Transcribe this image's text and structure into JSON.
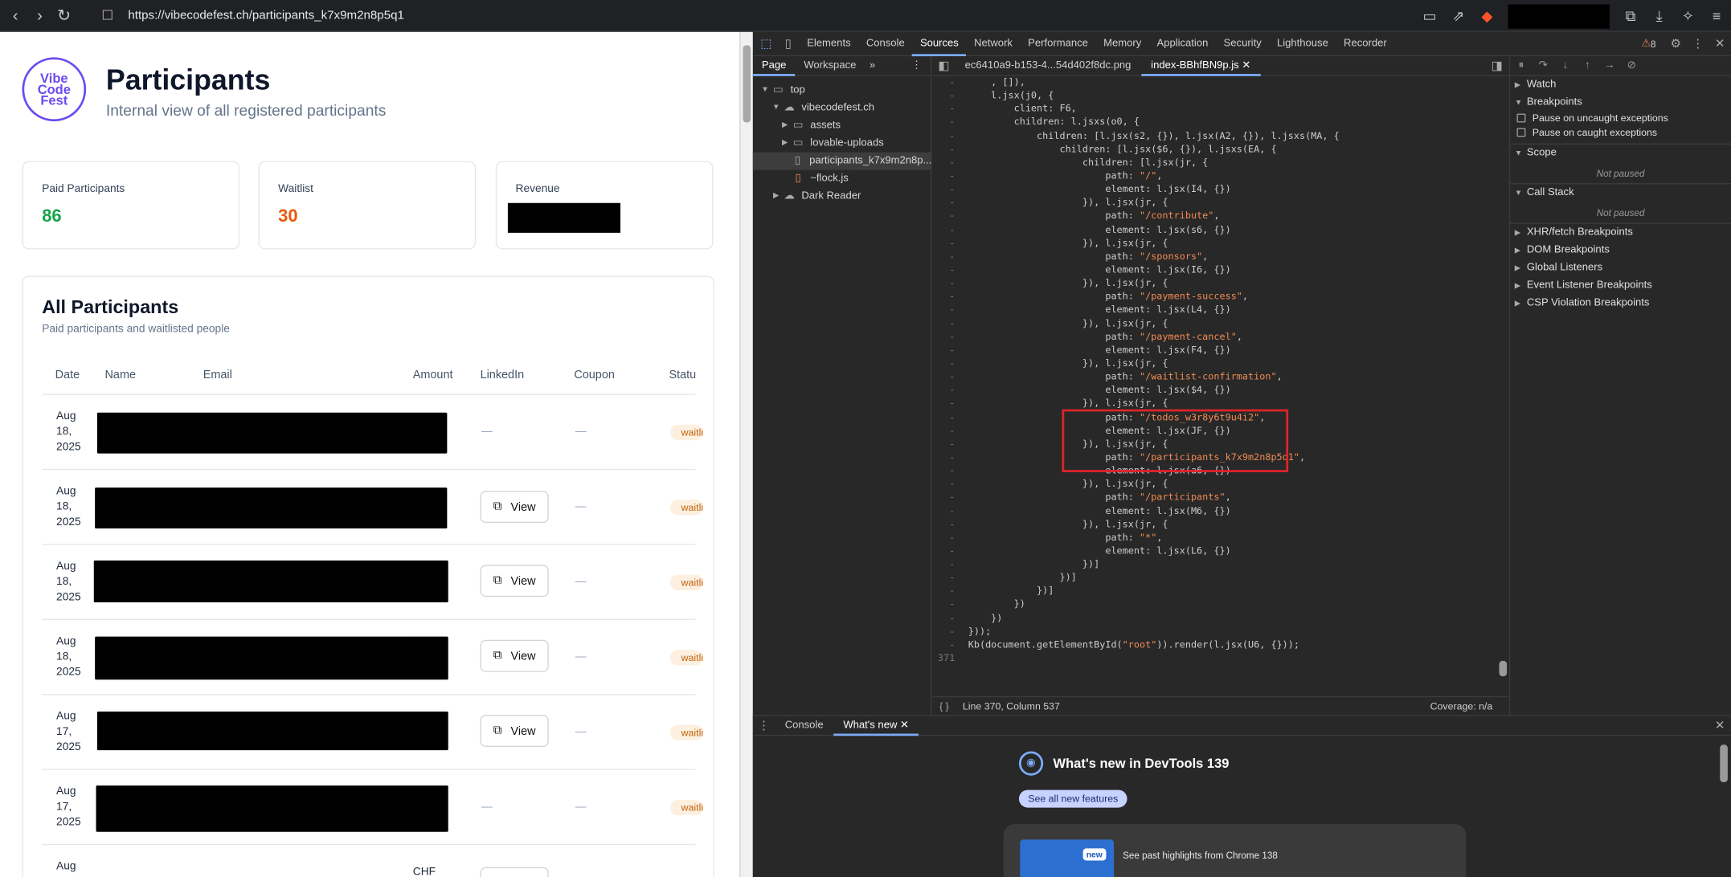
{
  "browser": {
    "url": "https://vibecodefest.ch/participants_k7x9m2n8p5q1",
    "back_icon": "chevron-left-icon",
    "forward_icon": "chevron-right-icon",
    "reload_icon": "reload-icon",
    "bookmark_icon": "bookmark-icon"
  },
  "page": {
    "logo_lines": [
      "Vibe",
      "Code",
      "Fest"
    ],
    "title": "Participants",
    "subtitle": "Internal view of all registered participants",
    "stats": [
      {
        "label": "Paid Participants",
        "value": "86",
        "color": "#16a34a"
      },
      {
        "label": "Waitlist",
        "value": "30",
        "color": "#ea580c"
      },
      {
        "label": "Revenue",
        "value": ""
      }
    ],
    "table": {
      "title": "All Participants",
      "subtitle": "Paid participants and waitlisted people",
      "columns": [
        "Date",
        "Name",
        "Email",
        "Amount",
        "LinkedIn",
        "Coupon",
        "Status"
      ],
      "rows": [
        {
          "month": "Aug",
          "day": "18,",
          "year": "2025",
          "linkedin": "—",
          "coupon": "—",
          "status": "waitlist"
        },
        {
          "month": "Aug",
          "day": "18,",
          "year": "2025",
          "linkedin": "View",
          "coupon": "—",
          "status": "waitlist"
        },
        {
          "month": "Aug",
          "day": "18,",
          "year": "2025",
          "linkedin": "View",
          "coupon": "—",
          "status": "waitlist"
        },
        {
          "month": "Aug",
          "day": "18,",
          "year": "2025",
          "linkedin": "View",
          "coupon": "—",
          "status": "waitlist"
        },
        {
          "month": "Aug",
          "day": "17,",
          "year": "2025",
          "linkedin": "View",
          "coupon": "—",
          "status": "waitlist"
        },
        {
          "month": "Aug",
          "day": "17,",
          "year": "2025",
          "linkedin": "—",
          "coupon": "—",
          "status": "waitlist"
        },
        {
          "month": "Aug",
          "day": "",
          "year": "",
          "amount": "CHF",
          "linkedin": "",
          "coupon": "",
          "status": ""
        }
      ]
    }
  },
  "devtools": {
    "tabs": [
      "Elements",
      "Console",
      "Sources",
      "Network",
      "Performance",
      "Memory",
      "Application",
      "Security",
      "Lighthouse",
      "Recorder"
    ],
    "active_tab": "Sources",
    "warning_count": "8",
    "navigator": {
      "tabs": [
        "Page",
        "Workspace"
      ],
      "tree": [
        {
          "label": "top",
          "indent": 0,
          "arrow": "▼",
          "icon": "frame-icon"
        },
        {
          "label": "vibecodefest.ch",
          "indent": 1,
          "arrow": "▼",
          "icon": "cloud-icon"
        },
        {
          "label": "assets",
          "indent": 2,
          "arrow": "▶",
          "icon": "folder-icon"
        },
        {
          "label": "lovable-uploads",
          "indent": 2,
          "arrow": "▶",
          "icon": "folder-icon"
        },
        {
          "label": "participants_k7x9m2n8p...",
          "indent": 2,
          "arrow": "",
          "icon": "file-icon",
          "selected": true
        },
        {
          "label": "~flock.js",
          "indent": 2,
          "arrow": "",
          "icon": "file-icon"
        },
        {
          "label": "Dark Reader",
          "indent": 0,
          "arrow": "▶",
          "icon": "cloud-icon"
        }
      ]
    },
    "editor_tabs": [
      "ec6410a9-b153-4...54d402f8dc.png",
      "index-BBhfBN9p.js"
    ],
    "code_lines": [
      {
        "n": "-",
        "t": "    , []),"
      },
      {
        "n": "-",
        "t": "    l.jsx(j0, {"
      },
      {
        "n": "-",
        "t": "        client: F6,"
      },
      {
        "n": "-",
        "t": "        children: l.jsxs(o0, {"
      },
      {
        "n": "-",
        "t": "            children: [l.jsx(s2, {}), l.jsx(A2, {}), l.jsxs(MA, {"
      },
      {
        "n": "-",
        "t": "                children: [l.jsx($6, {}), l.jsxs(EA, {"
      },
      {
        "n": "-",
        "t": "                    children: [l.jsx(jr, {"
      },
      {
        "n": "-",
        "t": "                        path: ",
        "s": "\"/\"",
        "e": ","
      },
      {
        "n": "-",
        "t": "                        element: l.jsx(I4, {})"
      },
      {
        "n": "-",
        "t": "                    }), l.jsx(jr, {"
      },
      {
        "n": "-",
        "t": "                        path: ",
        "s": "\"/contribute\"",
        "e": ","
      },
      {
        "n": "-",
        "t": "                        element: l.jsx(s6, {})"
      },
      {
        "n": "-",
        "t": "                    }), l.jsx(jr, {"
      },
      {
        "n": "-",
        "t": "                        path: ",
        "s": "\"/sponsors\"",
        "e": ","
      },
      {
        "n": "-",
        "t": "                        element: l.jsx(I6, {})"
      },
      {
        "n": "-",
        "t": "                    }), l.jsx(jr, {"
      },
      {
        "n": "-",
        "t": "                        path: ",
        "s": "\"/payment-success\"",
        "e": ","
      },
      {
        "n": "-",
        "t": "                        element: l.jsx(L4, {})"
      },
      {
        "n": "-",
        "t": "                    }), l.jsx(jr, {"
      },
      {
        "n": "-",
        "t": "                        path: ",
        "s": "\"/payment-cancel\"",
        "e": ","
      },
      {
        "n": "-",
        "t": "                        element: l.jsx(F4, {})"
      },
      {
        "n": "-",
        "t": "                    }), l.jsx(jr, {"
      },
      {
        "n": "-",
        "t": "                        path: ",
        "s": "\"/waitlist-confirmation\"",
        "e": ","
      },
      {
        "n": "-",
        "t": "                        element: l.jsx($4, {})"
      },
      {
        "n": "-",
        "t": "                    }), l.jsx(jr, {"
      },
      {
        "n": "-",
        "t": "                        path: ",
        "s": "\"/todos_w3r8y6t9u4i2\"",
        "e": ","
      },
      {
        "n": "-",
        "t": "                        element: l.jsx(JF, {})"
      },
      {
        "n": "-",
        "t": "                    }), l.jsx(jr, {"
      },
      {
        "n": "-",
        "t": "                        path: ",
        "s": "\"/participants_k7x9m2n8p5q1\"",
        "e": ","
      },
      {
        "n": "-",
        "t": "                        element: l.jsx(a6, {})"
      },
      {
        "n": "-",
        "t": "                    }), l.jsx(jr, {"
      },
      {
        "n": "-",
        "t": "                        path: ",
        "s": "\"/participants\"",
        "e": ","
      },
      {
        "n": "-",
        "t": "                        element: l.jsx(M6, {})"
      },
      {
        "n": "-",
        "t": "                    }), l.jsx(jr, {"
      },
      {
        "n": "-",
        "t": "                        path: ",
        "s": "\"*\"",
        "e": ","
      },
      {
        "n": "-",
        "t": "                        element: l.jsx(L6, {})"
      },
      {
        "n": "-",
        "t": "                    })]"
      },
      {
        "n": "-",
        "t": "                })]"
      },
      {
        "n": "-",
        "t": "            })]"
      },
      {
        "n": "-",
        "t": "        })"
      },
      {
        "n": "-",
        "t": "    })"
      },
      {
        "n": "-",
        "t": "}));"
      },
      {
        "n": "-",
        "t": "Kb(document.getElementById(",
        "s": "\"root\"",
        "e": ")).render(l.jsx(U6, {}));"
      },
      {
        "n": "371",
        "t": ""
      }
    ],
    "status_bar": {
      "position": "Line 370, Column 537",
      "coverage": "Coverage: n/a"
    },
    "debugger": {
      "sections": [
        {
          "label": "Watch",
          "arrow": "▶"
        },
        {
          "label": "Breakpoints",
          "arrow": "▼"
        }
      ],
      "checkboxes": [
        "Pause on uncaught exceptions",
        "Pause on caught exceptions"
      ],
      "scope": {
        "label": "Scope",
        "arrow": "▼",
        "note": "Not paused"
      },
      "call_stack": {
        "label": "Call Stack",
        "arrow": "▼",
        "note": "Not paused"
      },
      "more": [
        "XHR/fetch Breakpoints",
        "DOM Breakpoints",
        "Global Listeners",
        "Event Listener Breakpoints",
        "CSP Violation Breakpoints"
      ]
    },
    "drawer": {
      "tabs": [
        "Console",
        "What's new"
      ],
      "title": "What's new in DevTools 139",
      "button": "See all new features",
      "badge": "new",
      "card_text": "See past highlights from Chrome 138"
    }
  },
  "colors": {
    "accent": "#6c4bf0",
    "highlight_box": "#e0232a",
    "devtools_bg": "#282828"
  }
}
